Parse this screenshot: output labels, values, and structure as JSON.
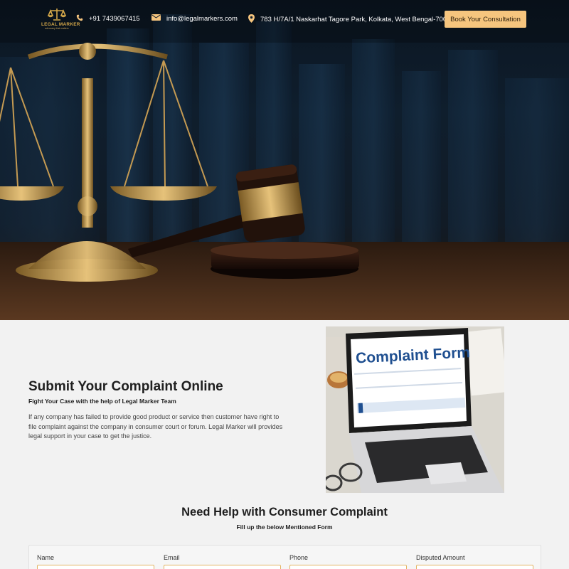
{
  "header": {
    "logo_text": "LEGAL MARKER",
    "logo_tagline": "advocacy that matters",
    "phone": "+91 7439067415",
    "email": "info@legalmarkers.com",
    "address": "783 H/7A/1 Naskarhat Tagore Park, Kolkata, West Bengal-700039",
    "cta_label": "Book Your Consultation",
    "icons": {
      "phone": "phone-icon",
      "email": "mail-icon",
      "address": "location-pin-icon"
    }
  },
  "intro": {
    "title": "Submit Your Complaint Online",
    "subtitle": "Fight Your Case with the help of Legal Marker Team",
    "body": "If any company has failed to provide good product or service then customer have right to file complaint against the company in consumer court or forum. Legal Marker will provides legal support in your case to get the justice.",
    "photo_heading": "Complaint Form"
  },
  "form": {
    "title": "Need Help with Consumer Complaint",
    "subtitle": "Fill up the below Mentioned Form",
    "fields": [
      {
        "label": "Name",
        "value": ""
      },
      {
        "label": "Email",
        "value": ""
      },
      {
        "label": "Phone",
        "value": ""
      },
      {
        "label": "Disputed Amount",
        "value": ""
      }
    ]
  },
  "colors": {
    "accent": "#f6c57e",
    "gold": "#d6a94a",
    "hero_dark": "#0f1e2d"
  }
}
